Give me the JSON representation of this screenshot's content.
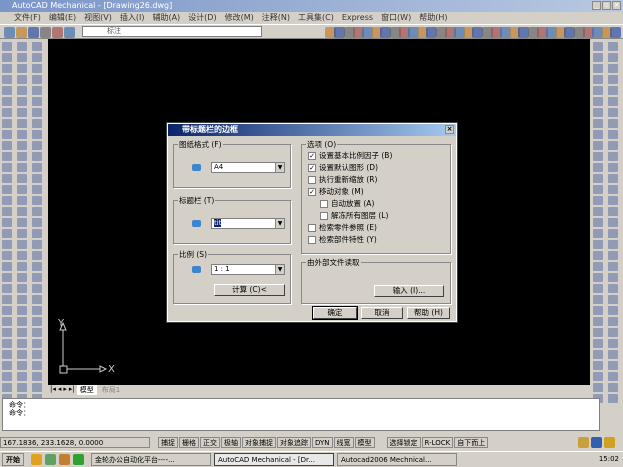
{
  "window": {
    "title": "AutoCAD Mechanical - [Drawing26.dwg]",
    "min": "_",
    "max": "▫",
    "close": "×"
  },
  "menu": [
    "文件(F)",
    "编辑(E)",
    "视图(V)",
    "插入(I)",
    "辅助(A)",
    "设计(D)",
    "修改(M)",
    "注释(N)",
    "工具集(C)",
    "Express",
    "窗口(W)",
    "帮助(H)"
  ],
  "toolbar": {
    "layer_value": "标注"
  },
  "dialog": {
    "title": "带标题栏的边框",
    "close": "×",
    "paper_format": {
      "label": "图纸格式 (F)",
      "value": "A4"
    },
    "title_block": {
      "label": "标题栏 (T)",
      "value": "tit"
    },
    "scale": {
      "label": "比例 (S)",
      "value": "1 : 1",
      "calc_button": "计算 (C)<"
    },
    "options": {
      "label": "选项 (O)",
      "items": [
        {
          "label": "设置基本比例因子 (B)",
          "checked": true,
          "indent": false
        },
        {
          "label": "设置默认图形 (D)",
          "checked": true,
          "indent": false
        },
        {
          "label": "执行重新缩放 (R)",
          "checked": false,
          "indent": false
        },
        {
          "label": "移动对象 (M)",
          "checked": true,
          "indent": false
        },
        {
          "label": "自动放置 (A)",
          "checked": false,
          "indent": true
        },
        {
          "label": "解冻所有图层 (L)",
          "checked": false,
          "indent": true
        },
        {
          "label": "检索零件参照 (E)",
          "checked": false,
          "indent": false
        },
        {
          "label": "检索部件特性 (Y)",
          "checked": false,
          "indent": false
        }
      ]
    },
    "external": {
      "label": "由外部文件读取",
      "import_button": "输入 (I)..."
    },
    "ok": "确定",
    "cancel": "取消",
    "help": "帮助 (H)"
  },
  "ucs": {
    "x": "X",
    "y": "Y"
  },
  "tabs": [
    "模型",
    "布局1"
  ],
  "command": {
    "lines": [
      "命令：",
      "命令："
    ]
  },
  "status": {
    "coords": "167.1836,  233.1628,  0.0000",
    "buttons": [
      "捕捉",
      "栅格",
      "正交",
      "极轴",
      "对象捕捉",
      "对象追踪",
      "DYN",
      "线宽",
      "模型"
    ],
    "extra": [
      "选择锁定",
      "R-LOCK",
      "自下而上"
    ]
  },
  "taskbar": {
    "start": "开始",
    "tasks": [
      "金轮办公自动化平台----...",
      "AutoCAD Mechanical - [Dr...",
      "Autocad2006 Mechnical..."
    ],
    "clock": "15:02"
  }
}
